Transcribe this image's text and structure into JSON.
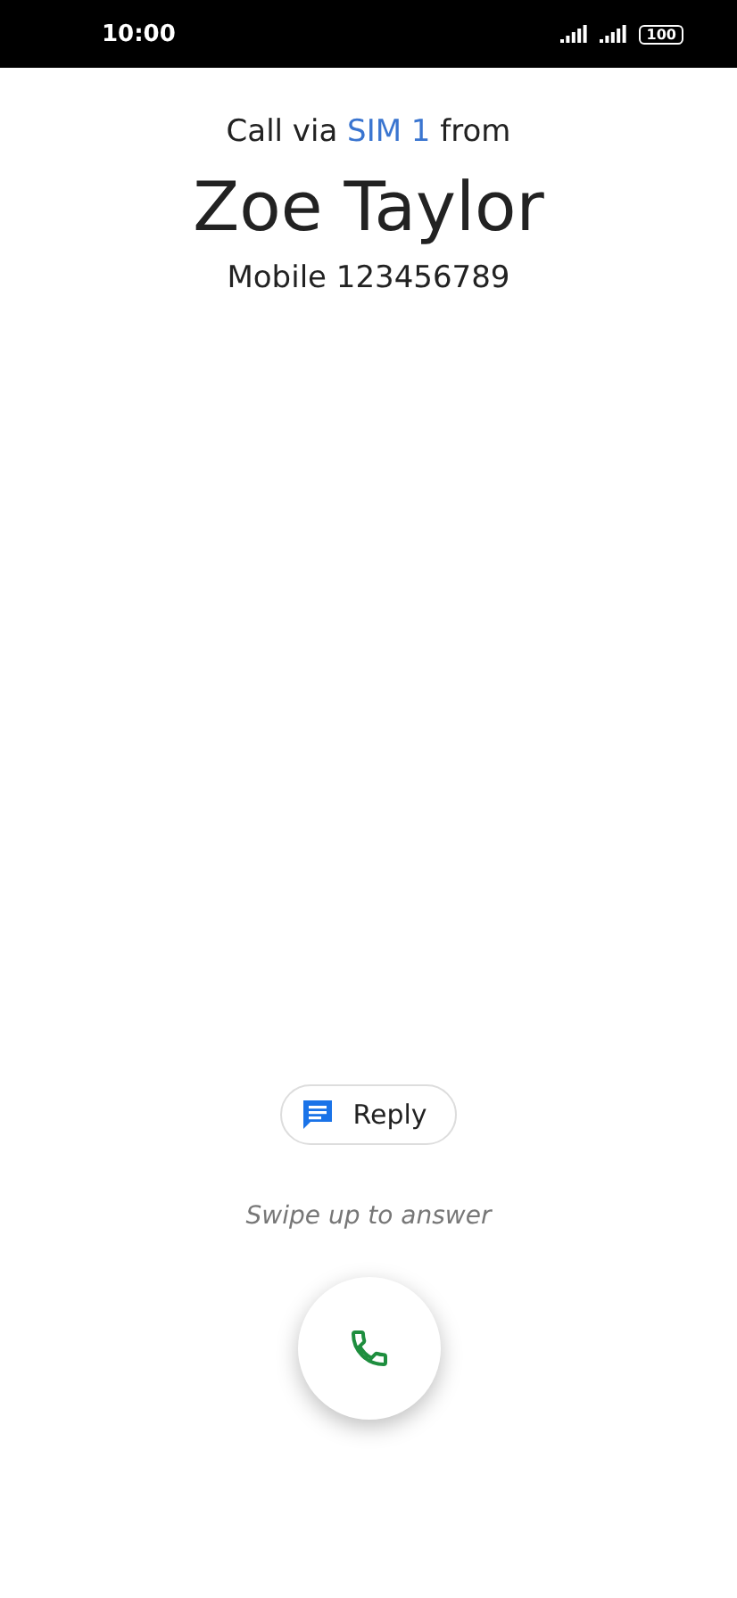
{
  "status_bar": {
    "time": "10:00",
    "battery": "100"
  },
  "caller": {
    "via_prefix": "Call via",
    "sim": "SIM 1",
    "via_suffix": "from",
    "name": "Zoe Taylor",
    "number": "Mobile 123456789"
  },
  "reply_button": {
    "label": "Reply"
  },
  "hint": "Swipe up to answer"
}
